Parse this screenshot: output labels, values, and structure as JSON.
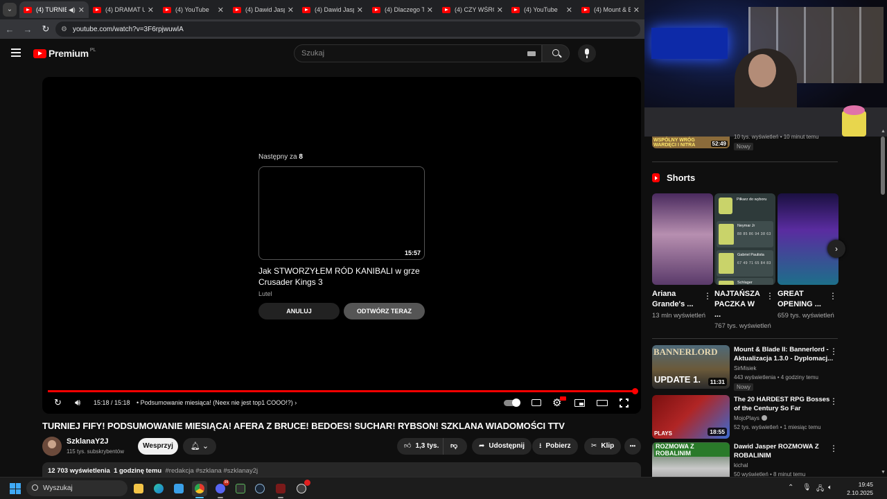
{
  "browser": {
    "tabs": [
      {
        "label": "(4) TURNIE",
        "active": true
      },
      {
        "label": "(4) DRAMAT Ur"
      },
      {
        "label": "(4) YouTube"
      },
      {
        "label": "(4) Dawid Jasp"
      },
      {
        "label": "(4) Dawid Jasp"
      },
      {
        "label": "(4) Dlaczego Ta"
      },
      {
        "label": "(4) CZY WŚRÓ"
      },
      {
        "label": "(4) YouTube"
      },
      {
        "label": "(4) Mount & Bl"
      }
    ],
    "url": "youtube.com/watch?v=3F6rpjwuwlA"
  },
  "youtube": {
    "logo_text": "Premium",
    "logo_country": "PL",
    "search_placeholder": "Szukaj"
  },
  "player": {
    "upnext_prefix": "Następny za",
    "upnext_count": "8",
    "upnext_duration": "15:57",
    "upnext_title": "Jak STWORZYŁEM RÓD KANIBALI w grze Crusader Kings 3",
    "upnext_channel": "Lutel",
    "cancel_label": "ANULUJ",
    "play_now_label": "ODTWÓRZ TERAZ",
    "time": "15:18 / 15:18",
    "chapter": "Podsumowanie miesiąca! (Neex nie jest top1 COOO!?)",
    "chapter_arrow": "›",
    "progress": 1.0
  },
  "video": {
    "title": "TURNIEJ FIFY! PODSUMOWANIE MIESIĄCA! AFERA Z BRUCE! BEDOES! SUCHAR! RYBSON! SZKLANA WIADOMOŚCI TTV",
    "channel": "SzklanaY2J",
    "subscribers": "115 tys. subskrybentów",
    "join_label": "Wesprzyj",
    "likes": "1,3 tys.",
    "share_label": "Udostępnij",
    "download_label": "Pobierz",
    "clip_label": "Klip",
    "more": "•••",
    "views": "12 703 wyświetlenia",
    "ago": "1 godzinę temu",
    "tags": "#redakcja #szklana #szklanay2j"
  },
  "sidebar": {
    "top_item": {
      "thumb_text_1": "WSPÓLNY WRÓG",
      "thumb_text_2": "WARDĘCI I NITRA",
      "duration": "52:49",
      "meta": "10 tys. wyświetleń • 10 minut temu",
      "badge": "Nowy"
    },
    "shorts_title": "Shorts",
    "shorts": [
      {
        "title": "Ariana Grande's ...",
        "views": "13 mln wyświetleń"
      },
      {
        "title": "NAJTAŃSZA PACZKA W ...",
        "views": "767 tys. wyświetleń"
      },
      {
        "title": "GREAT OPENING ...",
        "views": "659 tys. wyświetleń"
      }
    ],
    "fifa": {
      "header": "Piłkarz do wyboru",
      "p1": "Neymar Jr",
      "p1_stats": "88 85 86 94 38 63",
      "p2": "Gabriel Paulista",
      "p2_stats": "67 49 71 65 84 83",
      "p3": "Schlager"
    },
    "videos": [
      {
        "title": "Mount & Blade II: Bannerlord - Aktualizacja 1.3.0 - Dyplomacj...",
        "channel": "SirMisiek",
        "meta": "443 wyświetlenia • 4 godziny temu",
        "badge": "Nowy",
        "duration": "11:31",
        "thumb_top": "BANNERLORD",
        "thumb_bottom": "UPDATE 1."
      },
      {
        "title": "The 20 HARDEST RPG Bosses of the Century So Far",
        "channel": "MojoPlays",
        "meta": "52 tys. wyświetleń • 1 miesiąc temu",
        "duration": "18:55",
        "thumb_bottom": "PLAYS"
      },
      {
        "title": "Dawid Jasper ROZMOWA Z ROBALINIM",
        "channel": "kichal",
        "meta": "50 wyświetleń • 8 minut temu",
        "thumb_top": "ROZMOWA Z ROBALINIM"
      }
    ]
  },
  "taskbar": {
    "search_label": "Wyszukaj",
    "time": "19:45",
    "date": "2.10.2025",
    "discord_badge": "99"
  },
  "colors": {
    "accent": "#ff0000",
    "background": "#0f0f0f",
    "chip": "#272727"
  }
}
